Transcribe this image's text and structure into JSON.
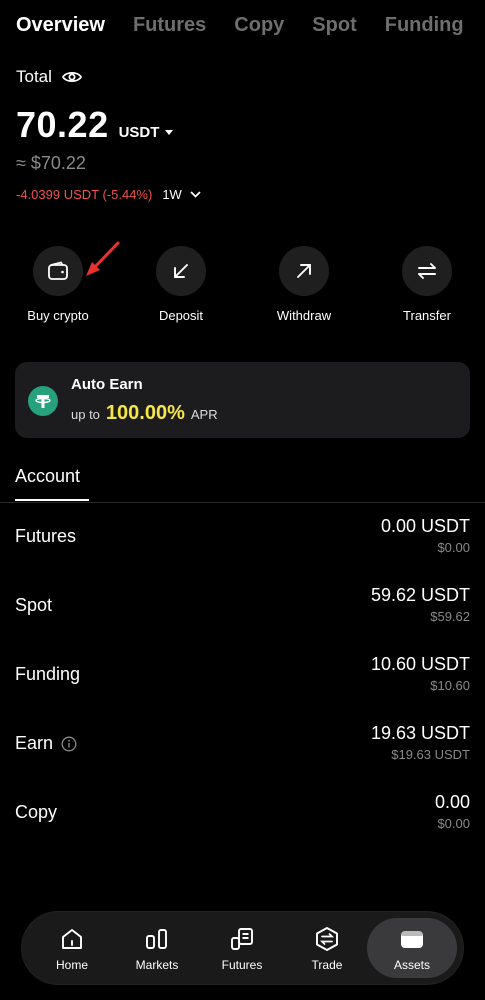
{
  "tabs": [
    "Overview",
    "Futures",
    "Copy",
    "Spot",
    "Funding"
  ],
  "balance": {
    "total_label": "Total",
    "value": "70.22",
    "currency": "USDT",
    "approx": "≈ $70.22",
    "change": "-4.0399 USDT (-5.44%)",
    "period": "1W"
  },
  "actions": [
    {
      "label": "Buy crypto",
      "icon": "wallet-icon"
    },
    {
      "label": "Deposit",
      "icon": "arrow-down-left-icon"
    },
    {
      "label": "Withdraw",
      "icon": "arrow-up-right-icon"
    },
    {
      "label": "Transfer",
      "icon": "transfer-icon"
    }
  ],
  "auto_earn": {
    "title": "Auto Earn",
    "prefix": "up to",
    "rate": "100.00%",
    "suffix": "APR"
  },
  "account": {
    "tab_label": "Account",
    "rows": [
      {
        "name": "Futures",
        "amount": "0.00 USDT",
        "fiat": "$0.00"
      },
      {
        "name": "Spot",
        "amount": "59.62 USDT",
        "fiat": "$59.62"
      },
      {
        "name": "Funding",
        "amount": "10.60 USDT",
        "fiat": "$10.60"
      },
      {
        "name": "Earn",
        "amount": "19.63 USDT",
        "fiat": "$19.63 USDT"
      },
      {
        "name": "Copy",
        "amount": "0.00",
        "fiat": "$0.00"
      }
    ]
  },
  "bottom_nav": [
    {
      "label": "Home",
      "icon": "home-icon"
    },
    {
      "label": "Markets",
      "icon": "markets-icon"
    },
    {
      "label": "Futures",
      "icon": "futures-icon"
    },
    {
      "label": "Trade",
      "icon": "trade-icon"
    },
    {
      "label": "Assets",
      "icon": "assets-icon"
    }
  ],
  "colors": {
    "negative": "#f0524d",
    "apr_highlight": "#f5e64a",
    "tether": "#26a17b"
  }
}
